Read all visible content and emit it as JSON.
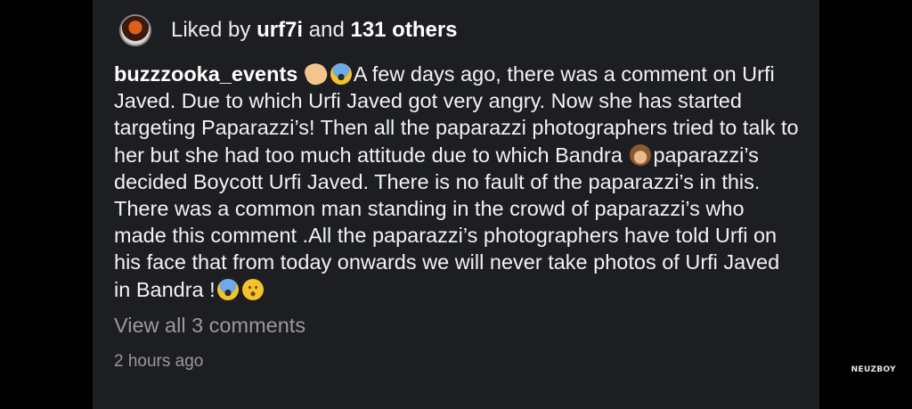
{
  "post": {
    "likes": {
      "prefix": "Liked by ",
      "user": "urf7i",
      "middle": " and ",
      "count": "131 others"
    },
    "caption": {
      "username": "buzzzooka_events",
      "emoji_after_username": [
        "pinching-hand-emoji",
        "face-screaming-emoji"
      ],
      "text_part1": "A few days ago, there was a comment on Urfi Javed. Due to which Urfi Javed got very angry. Now she has started targeting Paparazzi’s! Then all the paparazzi photographers tried to talk to her but she had too much attitude due to which Bandra ",
      "emoji_mid": "see-no-evil-monkey-emoji",
      "text_part2": "paparazzi’s decided Boycott Urfi Javed. There is no fault of the paparazzi’s in this. There was a common man standing in the crowd of paparazzi’s who made this comment .All the paparazzi’s photographers have told Urfi on his face that from today onwards we will never take photos of Urfi Javed in Bandra !",
      "emoji_end": [
        "face-screaming-emoji",
        "worried-face-emoji"
      ]
    },
    "view_comments": "View all 3 comments",
    "timestamp": "2 hours ago"
  },
  "watermark": "NEUZBOY",
  "colors": {
    "background": "#000000",
    "card": "#1c1e21",
    "text": "#f2f2f2",
    "muted": "#9a9a9a"
  }
}
